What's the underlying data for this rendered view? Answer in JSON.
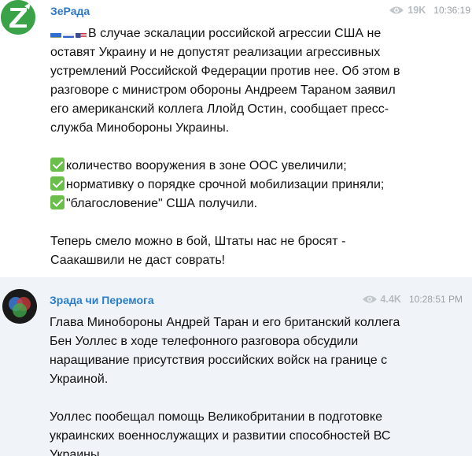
{
  "posts": [
    {
      "channel": "ЗеРада",
      "views": "19K",
      "time": "10:36:19",
      "avatar_icon": "z-letter-icon",
      "flags": [
        "ukraine-flag-icon",
        "russia-flag-icon",
        "usa-flag-icon"
      ],
      "lines": [
        "В случае эскалации российской агрессии США не",
        "оставят Украину и не допустят реализации агрессивных",
        "устремлений Российской Федерации против нее. Об этом в",
        "разговоре с министром обороны Андреем Тараном заявил",
        "его американский коллега Ллойд Остин, сообщает пресс-",
        "служба Минобороны Украины."
      ],
      "checklist": [
        "количество вооружения в зоне ООС увеличили;",
        "нормативку о порядке срочной мобилизации приняли;",
        "\"благословение\" США получили."
      ],
      "closing": [
        "Теперь смело можно в бой, Штаты нас не бросят -",
        "Саакашвили не даст соврать!"
      ]
    },
    {
      "channel": "Зрада чи Перемога",
      "views": "4.4K",
      "time": "10:28:51 PM",
      "avatar_icon": "venn-diagram-icon",
      "paragraph1": [
        "Глава Минобороны Андрей Таран и его британский коллега",
        "Бен Уоллес в ходе телефонного разговора обсудили",
        "наращивание присутствия российских войск на границе с",
        "Украиной."
      ],
      "paragraph2": [
        "Уоллес пообещал помощь Великобритании в подготовке",
        "украинских военнослужащих и развитии способностей ВС",
        "Украины."
      ]
    }
  ],
  "colors": {
    "channel_link": "#2e78c7",
    "meta_gray": "#9aa0a6",
    "post2_bg": "#f0f4f8",
    "check_green": "#6abf4b"
  }
}
